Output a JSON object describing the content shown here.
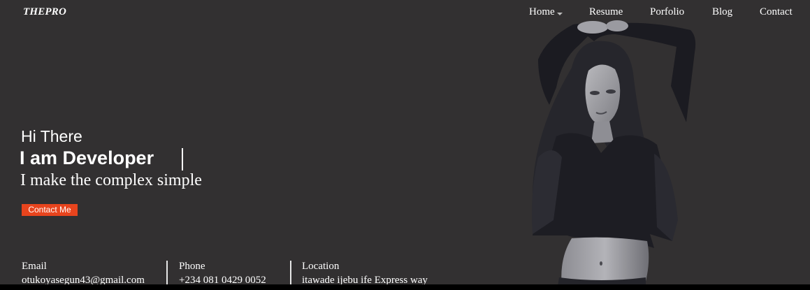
{
  "brand": {
    "logo": "THEPRO"
  },
  "nav": {
    "items": [
      {
        "label": "Home",
        "dropdown": true
      },
      {
        "label": "Resume"
      },
      {
        "label": "Porfolio"
      },
      {
        "label": "Blog"
      },
      {
        "label": "Contact"
      }
    ]
  },
  "hero": {
    "greeting": "Hi There",
    "role": "I am Developer",
    "tagline": "I make the complex simple",
    "cta_label": "Contact Me"
  },
  "contact_info": {
    "email": {
      "label": "Email",
      "value": "otukoyasegun43@gmail.com"
    },
    "phone": {
      "label": "Phone",
      "value": "+234 081 0429 0052"
    },
    "location": {
      "label": "Location",
      "value": "itawade ijebu ife Express way"
    }
  },
  "colors": {
    "background": "#323031",
    "accent": "#e8441d",
    "text": "#ffffff",
    "bottom_bar": "#000000"
  },
  "icons": [
    "caret-down-icon"
  ]
}
